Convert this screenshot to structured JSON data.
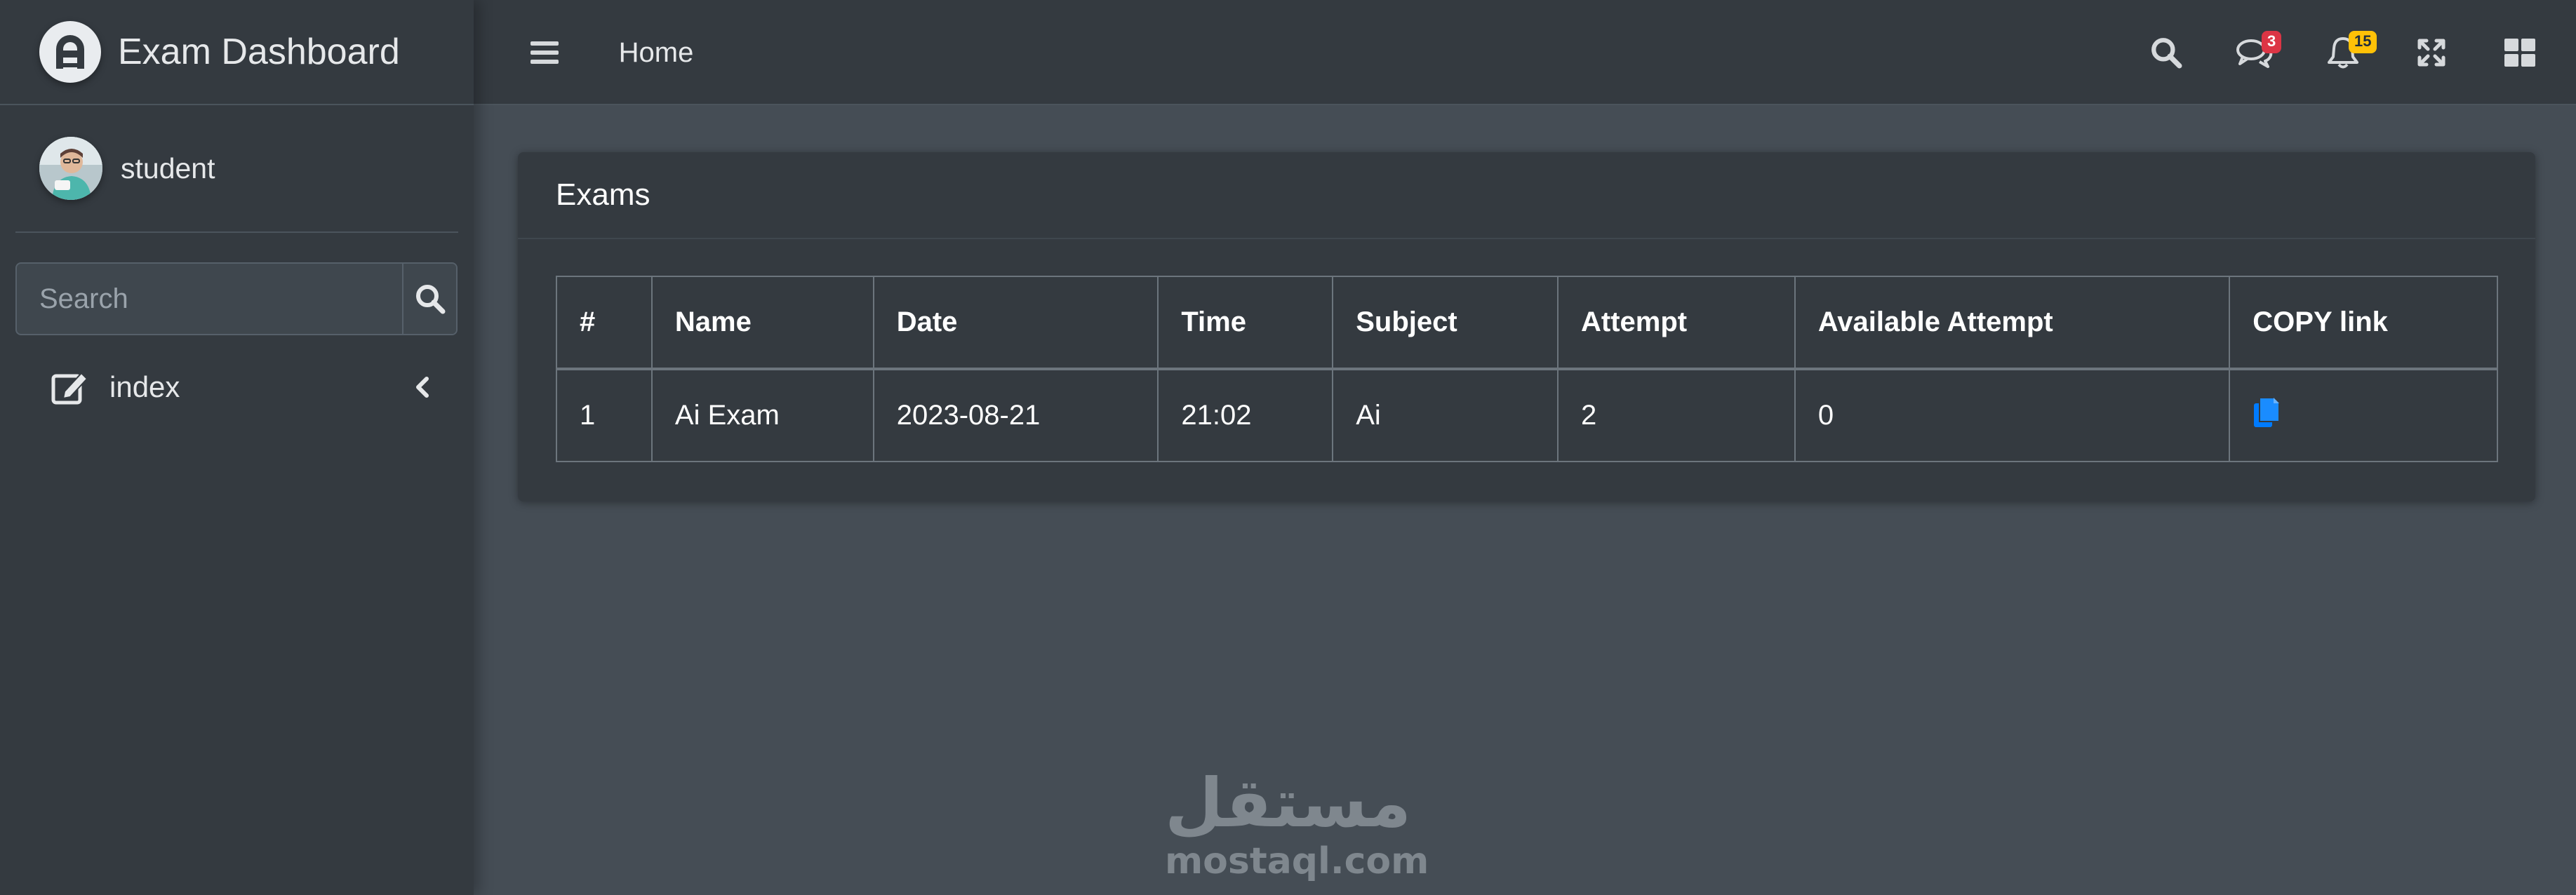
{
  "brand": {
    "title": "Exam Dashboard"
  },
  "user": {
    "name": "student"
  },
  "sidebar": {
    "search": {
      "placeholder": "Search"
    },
    "items": [
      {
        "label": "index",
        "icon": "edit-icon"
      }
    ]
  },
  "navbar": {
    "home_label": "Home",
    "messages_badge": "3",
    "notifications_badge": "15"
  },
  "exams_card": {
    "title": "Exams",
    "columns": [
      "#",
      "Name",
      "Date",
      "Time",
      "Subject",
      "Attempt",
      "Available Attempt",
      "COPY link"
    ],
    "rows": [
      {
        "num": "1",
        "name": "Ai Exam",
        "date": "2023-08-21",
        "time": "21:02",
        "subject": "Ai",
        "attempt": "2",
        "available_attempt": "0",
        "copy_icon": "copy-icon"
      }
    ]
  },
  "watermark": {
    "mark": "مستقل",
    "url": "mostaql.com"
  },
  "colors": {
    "background": "#454d55",
    "sidebar": "#343a40",
    "card": "#343a40",
    "link_blue": "#007bff",
    "badge_danger": "#dc3545",
    "badge_warning": "#ffc107"
  }
}
